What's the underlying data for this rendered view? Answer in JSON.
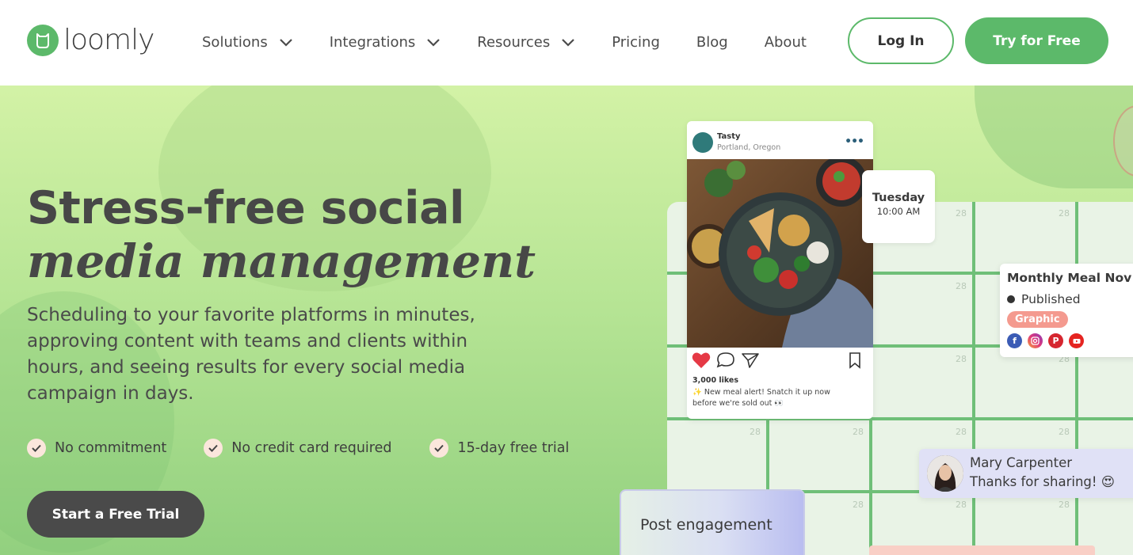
{
  "brand": {
    "name": "loomly",
    "accent": "#5cb96a"
  },
  "nav": {
    "items": [
      {
        "label": "Solutions",
        "has_dropdown": true
      },
      {
        "label": "Integrations",
        "has_dropdown": true
      },
      {
        "label": "Resources",
        "has_dropdown": true
      },
      {
        "label": "Pricing",
        "has_dropdown": false
      },
      {
        "label": "Blog",
        "has_dropdown": false
      },
      {
        "label": "About",
        "has_dropdown": false
      }
    ],
    "login_label": "Log In",
    "try_label": "Try for Free"
  },
  "hero": {
    "title_line1": "Stress-free social",
    "title_line2": "media management",
    "description": "Scheduling to your favorite platforms in minutes, approving content with teams and clients within hours, and seeing results for every social media campaign in days.",
    "checks": [
      "No commitment",
      "No credit card required",
      "15-day free trial"
    ],
    "cta_label": "Start a Free Trial"
  },
  "calendar": {
    "day_label": "28"
  },
  "instagram_post": {
    "account_name": "Tasty",
    "location": "Portland, Oregon",
    "likes": "3,000 likes",
    "caption": "✨ New meal alert! Snatch it up now before we're sold out 👀"
  },
  "schedule_card": {
    "day": "Tuesday",
    "time": "10:00 AM"
  },
  "meal_card": {
    "title": "Monthly Meal Nov",
    "status": "Published",
    "tag": "Graphic",
    "networks": [
      "facebook",
      "instagram",
      "pinterest",
      "youtube"
    ]
  },
  "comment": {
    "name": "Mary Carpenter",
    "text": "Thanks for sharing! 😍"
  },
  "engagement_card": {
    "label": "Post engagement"
  }
}
